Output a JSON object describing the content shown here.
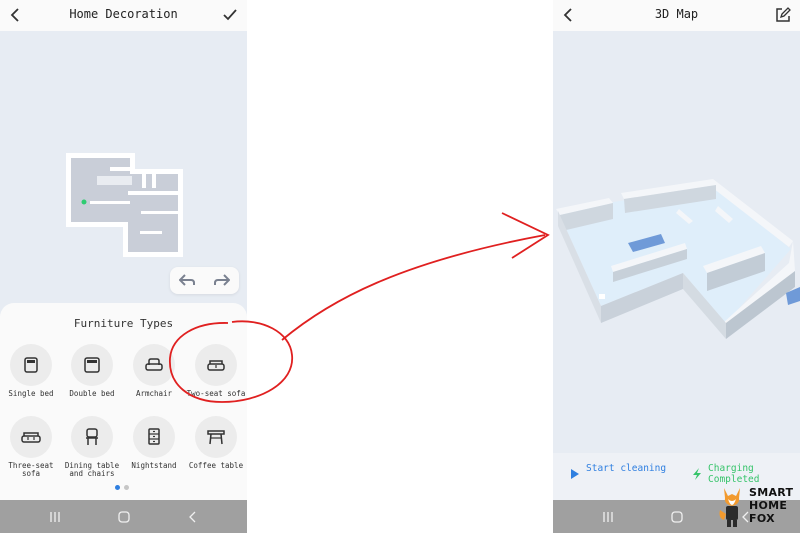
{
  "left_screen": {
    "header": {
      "title": "Home Decoration"
    },
    "furniture_panel": {
      "title": "Furniture Types",
      "items": [
        {
          "label": "Single bed",
          "icon": "single-bed-icon"
        },
        {
          "label": "Double bed",
          "icon": "double-bed-icon"
        },
        {
          "label": "Armchair",
          "icon": "armchair-icon"
        },
        {
          "label": "Two-seat sofa",
          "icon": "two-seat-sofa-icon"
        },
        {
          "label": "Three-seat sofa",
          "icon": "three-seat-sofa-icon"
        },
        {
          "label": "Dining table and chairs",
          "icon": "dining-table-icon"
        },
        {
          "label": "Nightstand",
          "icon": "nightstand-icon"
        },
        {
          "label": "Coffee table",
          "icon": "coffee-table-icon"
        }
      ],
      "pager": {
        "pages": 2,
        "current": 1
      }
    }
  },
  "right_screen": {
    "header": {
      "title": "3D Map"
    },
    "status": {
      "start_cleaning": "Start cleaning",
      "charging": "Charging Completed"
    }
  },
  "brand": {
    "line1": "SMART",
    "line2": "HOME",
    "line3": "FOX"
  },
  "colors": {
    "accent_blue": "#2f7fe0",
    "status_green": "#36c46a",
    "annotation_red": "#e02020",
    "background": "#e7ecf3",
    "nav_bar": "#a0a0a0"
  }
}
